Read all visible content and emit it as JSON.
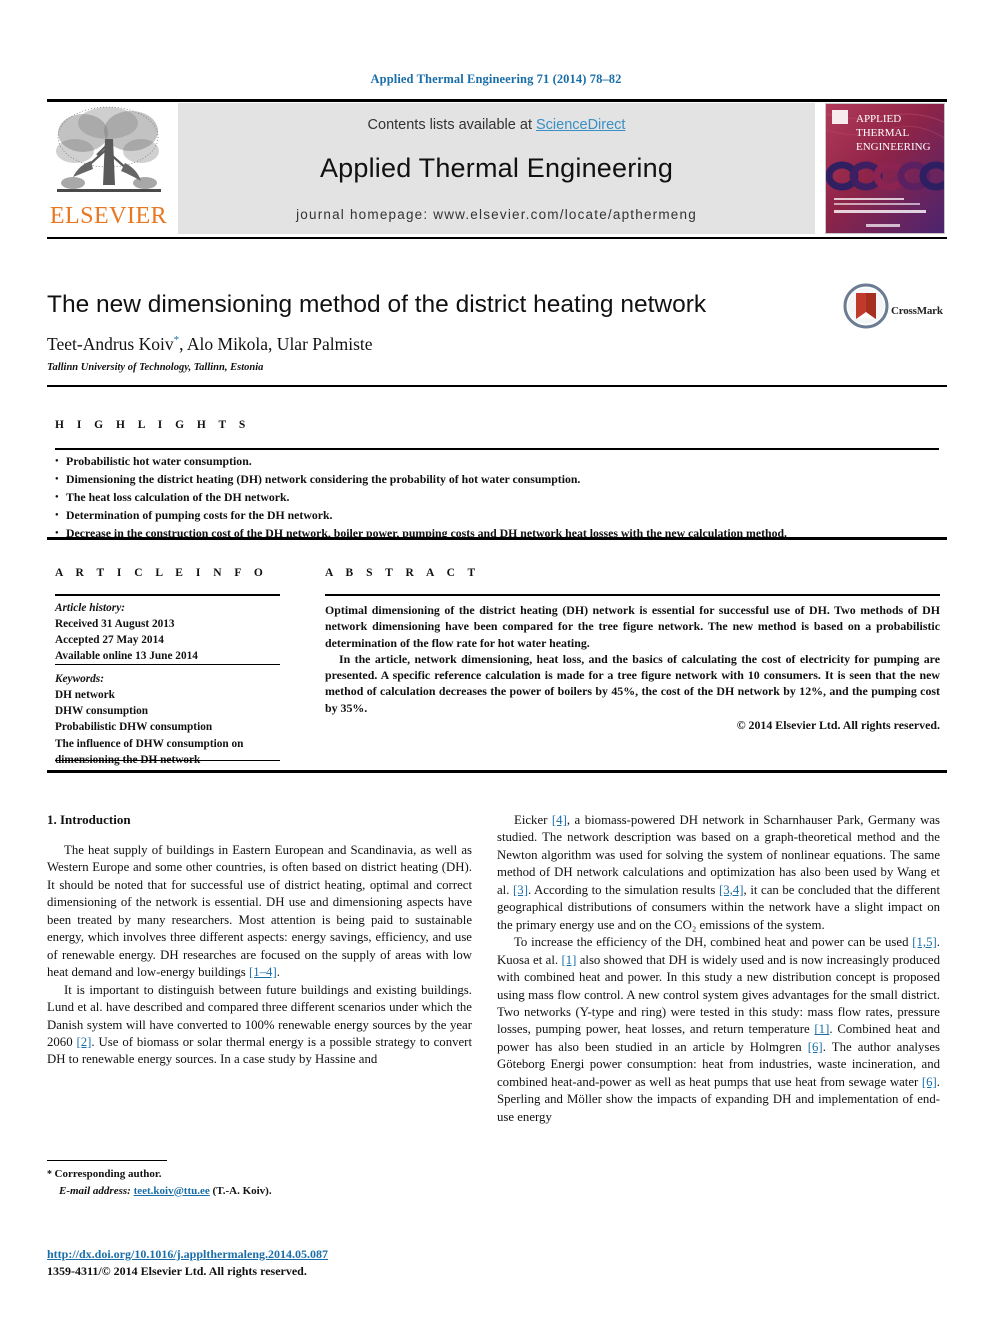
{
  "running_head": "Applied Thermal Engineering 71 (2014) 78–82",
  "masthead": {
    "contents_prefix": "Contents lists available at ",
    "sciencedirect": "ScienceDirect",
    "journal_name": "Applied Thermal Engineering",
    "homepage": "journal homepage: www.elsevier.com/locate/apthermeng",
    "publisher_wordmark": "ELSEVIER",
    "cover_title_lines": [
      "APPLIED",
      "THERMAL",
      "ENGINEERING"
    ],
    "colors": {
      "link": "#3a8fc4",
      "band": "#e3e3e3",
      "elsevier_orange": "#e87722",
      "running_head": "#1a6ea8"
    }
  },
  "article": {
    "title": "The new dimensioning method of the district heating network",
    "authors_prefix": "Teet-Andrus Koiv",
    "corresponding_marker": "*",
    "authors_suffix": ", Alo Mikola, Ular Palmiste",
    "affiliation": "Tallinn University of Technology, Tallinn, Estonia",
    "crossmark_label": "CrossMark"
  },
  "highlights": {
    "label": "H I G H L I G H T S",
    "items": [
      "Probabilistic hot water consumption.",
      "Dimensioning the district heating (DH) network considering the probability of hot water consumption.",
      "The heat loss calculation of the DH network.",
      "Determination of pumping costs for the DH network.",
      "Decrease in the construction cost of the DH network, boiler power, pumping costs and DH network heat losses with the new calculation method."
    ]
  },
  "article_info": {
    "label": "A R T I C L E  I N F O",
    "history_label": "Article history:",
    "history": [
      "Received 31 August 2013",
      "Accepted 27 May 2014",
      "Available online 13 June 2014"
    ],
    "keywords_label": "Keywords:",
    "keywords": [
      "DH network",
      "DHW consumption",
      "Probabilistic DHW consumption",
      "The influence of DHW consumption on dimensioning the DH network"
    ]
  },
  "abstract": {
    "label": "A B S T R A C T",
    "paragraphs": [
      "Optimal dimensioning of the district heating (DH) network is essential for successful use of DH. Two methods of DH network dimensioning have been compared for the tree figure network. The new method is based on a probabilistic determination of the flow rate for hot water heating.",
      "In the article, network dimensioning, heat loss, and the basics of calculating the cost of electricity for pumping are presented. A specific reference calculation is made for a tree figure network with 10 consumers. It is seen that the new method of calculation decreases the power of boilers by 45%, the cost of the DH network by 12%, and the pumping cost by 35%."
    ],
    "copyright": "© 2014 Elsevier Ltd. All rights reserved."
  },
  "body": {
    "section_heading": "1. Introduction",
    "left_paragraphs": [
      {
        "segments": [
          {
            "text": "The heat supply of buildings in Eastern European and Scandinavia, as well as Western Europe and some other countries, is often based on district heating (DH). It should be noted that for successful use of district heating, optimal and correct dimensioning of the network is essential. DH use and dimensioning aspects have been treated by many researchers. Most attention is being paid to sustainable energy, which involves three different aspects: energy savings, efficiency, and use of renewable energy. DH researches are focused on the supply of areas with low heat demand and low-energy buildings ",
            "type": "text"
          },
          {
            "text": "[1–4]",
            "type": "ref"
          },
          {
            "text": ".",
            "type": "text"
          }
        ]
      },
      {
        "segments": [
          {
            "text": "It is important to distinguish between future buildings and existing buildings. Lund et al. have described and compared three different scenarios under which the Danish system will have converted to 100% renewable energy sources by the year 2060 ",
            "type": "text"
          },
          {
            "text": "[2]",
            "type": "ref"
          },
          {
            "text": ". Use of biomass or solar thermal energy is a possible strategy to convert DH to renewable energy sources. In a case study by Hassine and",
            "type": "text"
          }
        ]
      }
    ],
    "right_paragraphs": [
      {
        "segments": [
          {
            "text": "Eicker ",
            "type": "text"
          },
          {
            "text": "[4]",
            "type": "ref"
          },
          {
            "text": ", a biomass-powered DH network in Scharnhauser Park, Germany was studied. The network description was based on a graph-theoretical method and the Newton algorithm was used for solving the system of nonlinear equations. The same method of DH network calculations and optimization has also been used by Wang et al. ",
            "type": "text"
          },
          {
            "text": "[3]",
            "type": "ref"
          },
          {
            "text": ". According to the simulation results ",
            "type": "text"
          },
          {
            "text": "[3,4]",
            "type": "ref"
          },
          {
            "text": ", it can be concluded that the different geographical distributions of consumers within the network have a slight impact on the primary energy use and on the CO₂ emissions of the system.",
            "type": "text"
          }
        ]
      },
      {
        "segments": [
          {
            "text": "To increase the efficiency of the DH, combined heat and power can be used ",
            "type": "text"
          },
          {
            "text": "[1,5]",
            "type": "ref"
          },
          {
            "text": ". Kuosa et al. ",
            "type": "text"
          },
          {
            "text": "[1]",
            "type": "ref"
          },
          {
            "text": " also showed that DH is widely used and is now increasingly produced with combined heat and power. In this study a new distribution concept is proposed using mass flow control. A new control system gives advantages for the small district. Two networks (Y-type and ring) were tested in this study: mass flow rates, pressure losses, pumping power, heat losses, and return temperature ",
            "type": "text"
          },
          {
            "text": "[1]",
            "type": "ref"
          },
          {
            "text": ". Combined heat and power has also been studied in an article by Holmgren ",
            "type": "text"
          },
          {
            "text": "[6]",
            "type": "ref"
          },
          {
            "text": ". The author analyses Göteborg Energi power consumption: heat from industries, waste incineration, and combined heat-and-power as well as heat pumps that use heat from sewage water ",
            "type": "text"
          },
          {
            "text": "[6]",
            "type": "ref"
          },
          {
            "text": ". Sperling and Möller show the impacts of expanding DH and implementation of end-use energy",
            "type": "text"
          }
        ]
      }
    ]
  },
  "footer": {
    "corresponding_author": "Corresponding author.",
    "email_label": "E-mail address:",
    "email": "teet.koiv@ttu.ee",
    "email_attrib": "(T.-A. Koiv).",
    "doi_url": "http://dx.doi.org/10.1016/j.applthermaleng.2014.05.087",
    "issn_line": "1359-4311/© 2014 Elsevier Ltd. All rights reserved."
  }
}
